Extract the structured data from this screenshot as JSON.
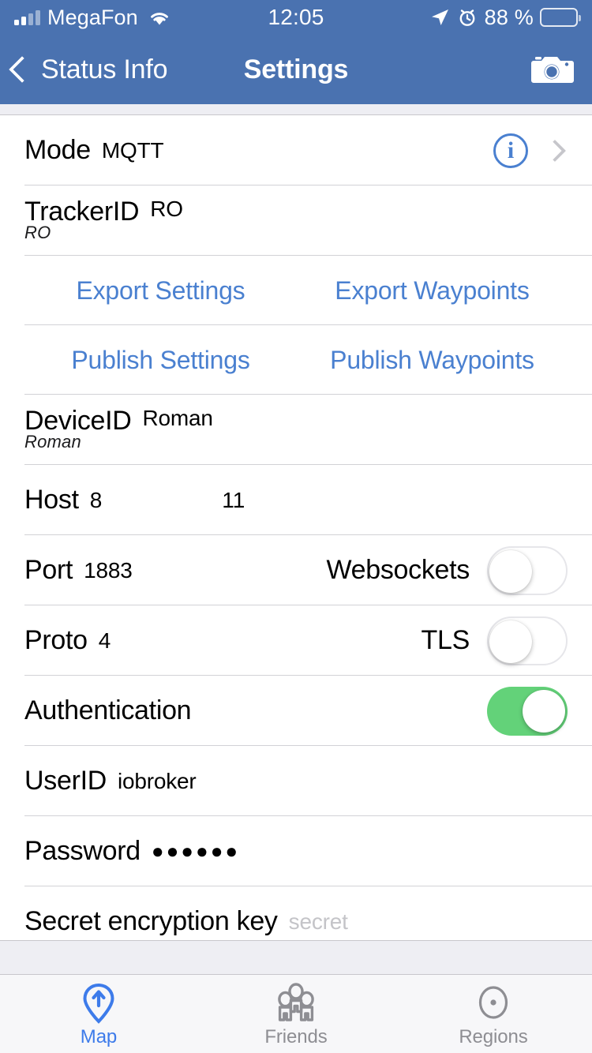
{
  "status_bar": {
    "carrier": "MegaFon",
    "time": "12:05",
    "battery_percent": "88 %",
    "icons": {
      "signal": "signal-bars-icon",
      "wifi": "wifi-icon",
      "location": "location-arrow-icon",
      "alarm": "alarm-clock-icon",
      "battery": "battery-icon"
    },
    "colors": {
      "background": "#4a72b0",
      "foreground": "#ffffff"
    }
  },
  "nav_bar": {
    "back_label": "Status Info",
    "title": "Settings",
    "back_icon": "chevron-left-icon",
    "action_icon": "camera-icon",
    "colors": {
      "background": "#4a72b0",
      "title": "#ffffff"
    }
  },
  "settings": {
    "mode": {
      "label": "Mode",
      "value": "MQTT",
      "info_icon": "info-circle-icon",
      "disclosure_icon": "chevron-right-icon"
    },
    "tracker_id": {
      "label": "TrackerID",
      "value": "RO",
      "subvalue": "RO"
    },
    "export_settings": "Export Settings",
    "export_waypoints": "Export Waypoints",
    "publish_settings": "Publish Settings",
    "publish_waypoints": "Publish Waypoints",
    "device_id": {
      "label": "DeviceID",
      "value": "Roman",
      "subvalue": "Roman"
    },
    "host": {
      "label": "Host",
      "value_start": "8",
      "value_end": "11"
    },
    "port": {
      "label": "Port",
      "value": "1883"
    },
    "websockets": {
      "label": "Websockets",
      "state": "off"
    },
    "proto": {
      "label": "Proto",
      "value": "4"
    },
    "tls": {
      "label": "TLS",
      "state": "off"
    },
    "authentication": {
      "label": "Authentication",
      "state": "on"
    },
    "user_id": {
      "label": "UserID",
      "value": "iobroker"
    },
    "password": {
      "label": "Password",
      "value": "●●●●●●"
    },
    "secret_key": {
      "label": "Secret encryption key",
      "placeholder": "secret"
    }
  },
  "tab_bar": {
    "tabs": [
      {
        "label": "Map",
        "icon": "map-pin-arrow-icon",
        "active": true
      },
      {
        "label": "Friends",
        "icon": "friends-group-icon",
        "active": false
      },
      {
        "label": "Regions",
        "icon": "region-circle-icon",
        "active": false
      }
    ],
    "colors": {
      "active": "#3d7bea",
      "inactive": "#8e8e93",
      "background": "#f7f7f9"
    }
  },
  "colors": {
    "link": "#4a80d0",
    "switch_on": "#63d279",
    "separator": "#c8c7cc",
    "gap_band": "#eeeef3"
  }
}
